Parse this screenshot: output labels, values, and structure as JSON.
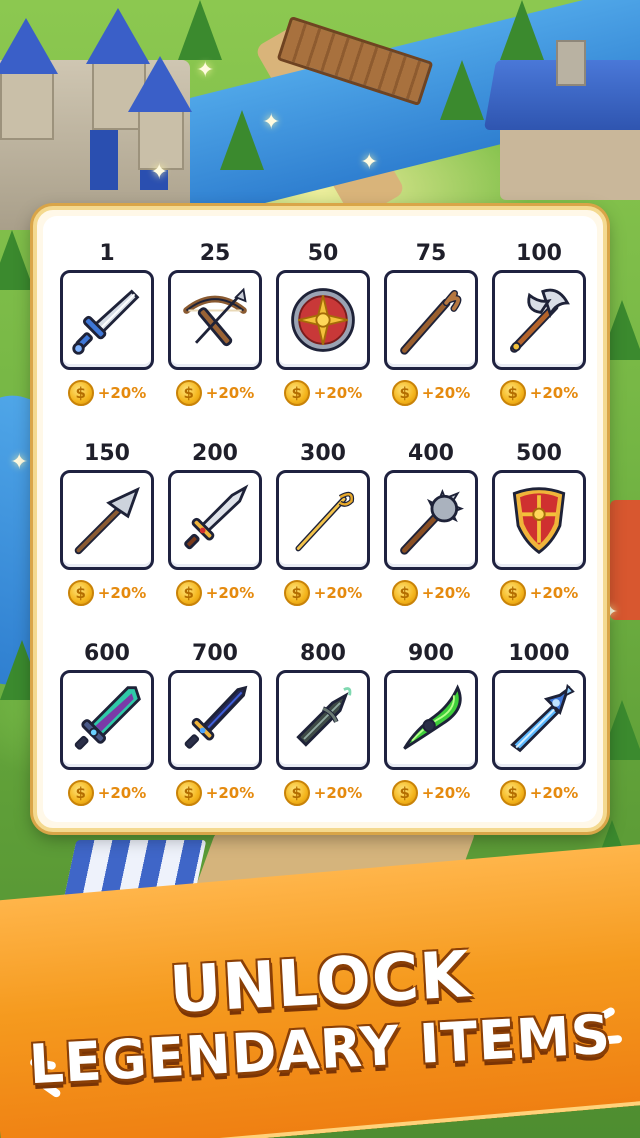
{
  "items": [
    {
      "level": "1",
      "bonus": "+20%",
      "icon": "sword-icon"
    },
    {
      "level": "25",
      "bonus": "+20%",
      "icon": "crossbow-icon"
    },
    {
      "level": "50",
      "bonus": "+20%",
      "icon": "round-shield-icon"
    },
    {
      "level": "75",
      "bonus": "+20%",
      "icon": "staff-icon"
    },
    {
      "level": "100",
      "bonus": "+20%",
      "icon": "battle-axe-icon"
    },
    {
      "level": "150",
      "bonus": "+20%",
      "icon": "spear-icon"
    },
    {
      "level": "200",
      "bonus": "+20%",
      "icon": "silver-sword-icon"
    },
    {
      "level": "300",
      "bonus": "+20%",
      "icon": "golden-rapier-icon"
    },
    {
      "level": "400",
      "bonus": "+20%",
      "icon": "mace-icon"
    },
    {
      "level": "500",
      "bonus": "+20%",
      "icon": "kite-shield-icon"
    },
    {
      "level": "600",
      "bonus": "+20%",
      "icon": "emerald-sword-icon"
    },
    {
      "level": "700",
      "bonus": "+20%",
      "icon": "dark-sword-icon"
    },
    {
      "level": "800",
      "bonus": "+20%",
      "icon": "cursed-dagger-icon"
    },
    {
      "level": "900",
      "bonus": "+20%",
      "icon": "jade-blade-icon"
    },
    {
      "level": "1000",
      "bonus": "+20%",
      "icon": "crystal-sword-icon"
    }
  ],
  "coin_symbol": "$",
  "headline": {
    "line1": "UNLOCK",
    "line2": "LEGENDARY ITEMS"
  },
  "colors": {
    "bonus_text": "#e58a0e",
    "banner": "#f59a1e",
    "item_border": "#1f2240"
  }
}
